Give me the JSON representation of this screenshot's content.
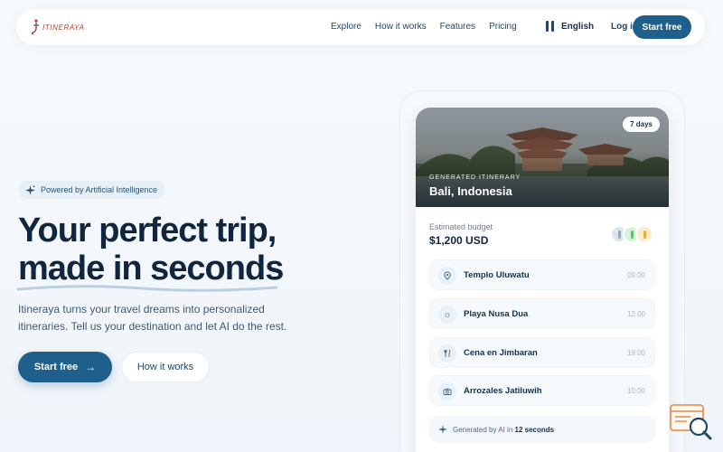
{
  "brand": {
    "name": "ITINERAYA"
  },
  "nav": {
    "links": [
      "Explore",
      "How it works",
      "Features",
      "Pricing"
    ],
    "language": "English",
    "login": "Log in",
    "cta": "Start free"
  },
  "hero": {
    "badge": "Powered by Artificial Intelligence",
    "title_line1": "Your perfect trip,",
    "title_line2": "made in seconds",
    "subtitle": "Itineraya turns your travel dreams into personalized itineraries. Tell us your destination and let AI do the rest.",
    "primary_cta": "Start free",
    "secondary_cta": "How it works"
  },
  "card": {
    "days_badge": "7 days",
    "generated_label": "GENERATED ITINERARY",
    "destination": "Bali, Indonesia",
    "budget_label": "Estimated budget",
    "budget_value": "$1,200 USD",
    "stops": [
      {
        "name": "Templo Uluwatu",
        "time": "09:00",
        "icon": "location-pin-icon"
      },
      {
        "name": "Playa Nusa Dua",
        "time": "12:00",
        "icon": "sun-icon"
      },
      {
        "name": "Cena en Jimbaran",
        "time": "19:00",
        "icon": "utensils-icon"
      },
      {
        "name": "Arrozales Jatiluwih",
        "time": "10:00",
        "icon": "camera-icon"
      }
    ],
    "footer_prefix": "Generated by AI in",
    "footer_time": "12 seconds"
  },
  "colors": {
    "primary": "#1f5f8b",
    "title": "#10263f",
    "text": "#3f5a73",
    "accent_red": "#c0392b"
  }
}
